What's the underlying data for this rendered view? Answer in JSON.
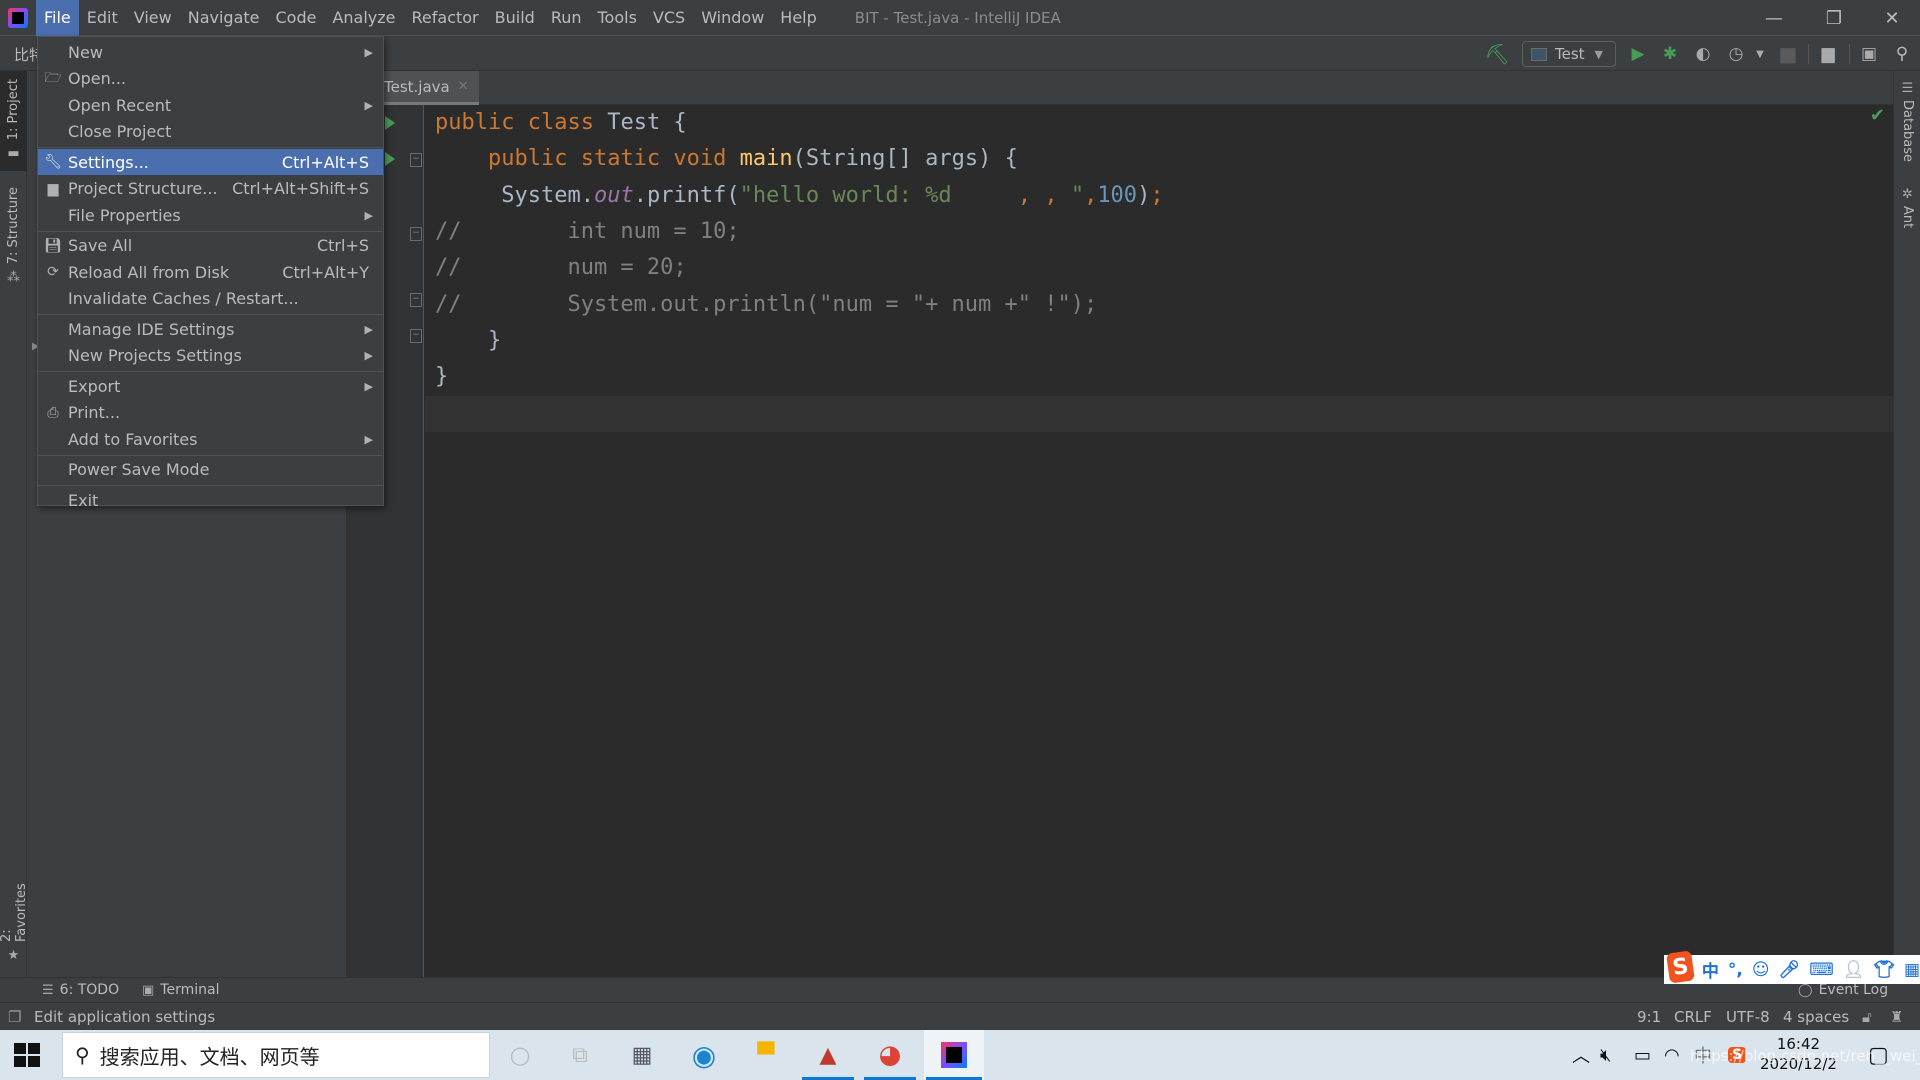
{
  "window": {
    "title": "BIT - Test.java - IntelliJ IDEA",
    "controls": {
      "minimize": "—",
      "restore": "❐",
      "close": "✕"
    }
  },
  "menubar": {
    "items": [
      "File",
      "Edit",
      "View",
      "Navigate",
      "Code",
      "Analyze",
      "Refactor",
      "Build",
      "Run",
      "Tools",
      "VCS",
      "Window",
      "Help"
    ],
    "active": "File"
  },
  "toolbar": {
    "nav_crumb": "比特",
    "run_config": "Test",
    "icons": [
      "build-hammer-icon",
      "run-icon",
      "debug-icon",
      "coverage-icon",
      "profile-icon",
      "stop-icon",
      "project-structure-icon",
      "run-anything-icon",
      "search-icon"
    ]
  },
  "left_strip": {
    "tabs": [
      {
        "label": "1: Project",
        "icon": "folder-icon",
        "active": true
      },
      {
        "label": "7: Structure",
        "icon": "structure-icon",
        "active": false
      },
      {
        "label": "2: Favorites",
        "icon": "star-icon",
        "active": false
      }
    ]
  },
  "right_strip": {
    "tabs": [
      {
        "label": "Database",
        "icon": "database-icon"
      },
      {
        "label": "Ant",
        "icon": "ant-icon"
      }
    ]
  },
  "editor": {
    "tab": {
      "label": "Test.java",
      "close": "✕"
    },
    "lines": [
      {
        "segments": [
          [
            "kw",
            "public "
          ],
          [
            "kw",
            "class "
          ],
          [
            "pl",
            "Test {"
          ]
        ]
      },
      {
        "segments": [
          [
            "pl",
            "    "
          ],
          [
            "kw",
            "public "
          ],
          [
            "kw",
            "static "
          ],
          [
            "kw",
            "void "
          ],
          [
            "fn",
            "main"
          ],
          [
            "pl",
            "(String[] args) {"
          ]
        ]
      },
      {
        "segments": [
          [
            "pl",
            "     System."
          ],
          [
            "fld",
            "out"
          ],
          [
            "pl",
            ".printf("
          ],
          [
            "str",
            "\"hello world: %d     "
          ],
          [
            "kw",
            ", , "
          ],
          [
            "str",
            "\""
          ],
          [
            "kw",
            ","
          ],
          [
            "num",
            "100"
          ],
          [
            "pl",
            ")"
          ],
          [
            "kw",
            ";"
          ]
        ]
      },
      {
        "segments": [
          [
            "cmt",
            "//        int num = 10;"
          ]
        ]
      },
      {
        "segments": [
          [
            "cmt",
            "//        num = 20;"
          ]
        ]
      },
      {
        "segments": [
          [
            "cmt",
            "//        System.out.println(\"num = \"+ num +\" !\");"
          ]
        ]
      },
      {
        "segments": [
          [
            "pl",
            "    }"
          ]
        ]
      },
      {
        "segments": [
          [
            "pl",
            "}"
          ]
        ]
      }
    ],
    "inspection_status": "✔"
  },
  "file_menu": {
    "items": [
      {
        "label": "New",
        "submenu": true
      },
      {
        "label": "Open...",
        "icon": "folder-open-icon"
      },
      {
        "label": "Open Recent",
        "submenu": true
      },
      {
        "label": "Close Project",
        "sep_after": true
      },
      {
        "label": "Settings...",
        "shortcut": "Ctrl+Alt+S",
        "icon": "wrench-icon",
        "selected": true
      },
      {
        "label": "Project Structure...",
        "shortcut": "Ctrl+Alt+Shift+S",
        "icon": "project-structure-icon"
      },
      {
        "label": "File Properties",
        "submenu": true,
        "sep_after": true
      },
      {
        "label": "Save All",
        "shortcut": "Ctrl+S",
        "icon": "save-icon"
      },
      {
        "label": "Reload All from Disk",
        "shortcut": "Ctrl+Alt+Y",
        "icon": "reload-icon"
      },
      {
        "label": "Invalidate Caches / Restart...",
        "sep_after": true
      },
      {
        "label": "Manage IDE Settings",
        "submenu": true
      },
      {
        "label": "New Projects Settings",
        "submenu": true,
        "sep_after": true
      },
      {
        "label": "Export",
        "submenu": true
      },
      {
        "label": "Print...",
        "icon": "printer-icon"
      },
      {
        "label": "Add to Favorites",
        "submenu": true,
        "sep_after": true
      },
      {
        "label": "Power Save Mode",
        "sep_after": true
      },
      {
        "label": "Exit"
      }
    ]
  },
  "bottom_bar": {
    "todo": "6: TODO",
    "terminal": "Terminal",
    "event_log": "Event Log"
  },
  "status_bar": {
    "message": "Edit application settings",
    "position": "9:1",
    "line_sep": "CRLF",
    "encoding": "UTF-8",
    "indent": "4 spaces"
  },
  "ime": {
    "logo": "S",
    "mode": "中",
    "punct": "°,",
    "icons": [
      "emoji-icon",
      "microphone-icon",
      "keyboard-icon",
      "user-icon",
      "skin-icon",
      "grid-icon"
    ]
  },
  "taskbar": {
    "search_placeholder": "搜索应用、文档、网页等",
    "apps": [
      "cortana",
      "task-view",
      "calculator",
      "edge",
      "file-explorer",
      "matlab",
      "chrome",
      "intellij-idea"
    ],
    "time": "16:42",
    "date": "2020/12/2",
    "ime_indicator": "中"
  },
  "watermark": "https://blog.csdn.net/ren__wei_"
}
